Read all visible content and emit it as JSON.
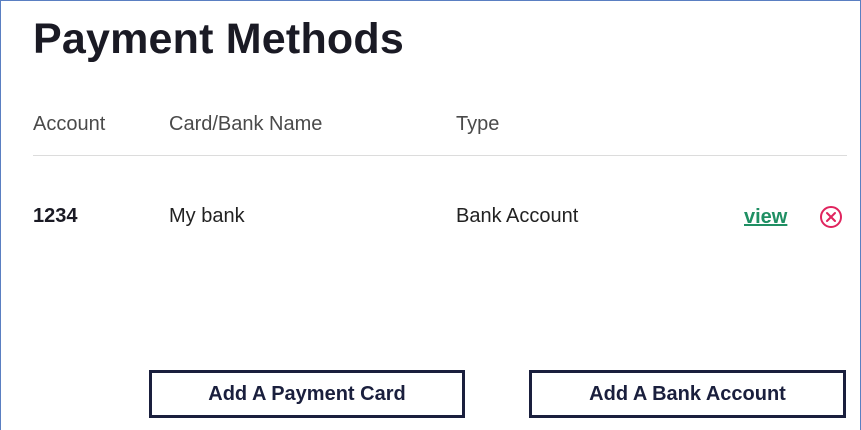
{
  "page": {
    "title": "Payment Methods"
  },
  "table": {
    "headers": {
      "account": "Account",
      "name": "Card/Bank Name",
      "type": "Type"
    },
    "rows": [
      {
        "account": "1234",
        "name": "My bank",
        "type": "Bank Account",
        "view_label": "view",
        "remove_icon": "close-circle-icon"
      }
    ]
  },
  "actions": {
    "add_card_label": "Add A Payment Card",
    "add_bank_label": "Add A Bank Account"
  },
  "colors": {
    "title": "#1a1a24",
    "link": "#1f8f63",
    "remove": "#e0245e",
    "button_border": "#1a1f3d",
    "divider": "#dcdcdc"
  }
}
